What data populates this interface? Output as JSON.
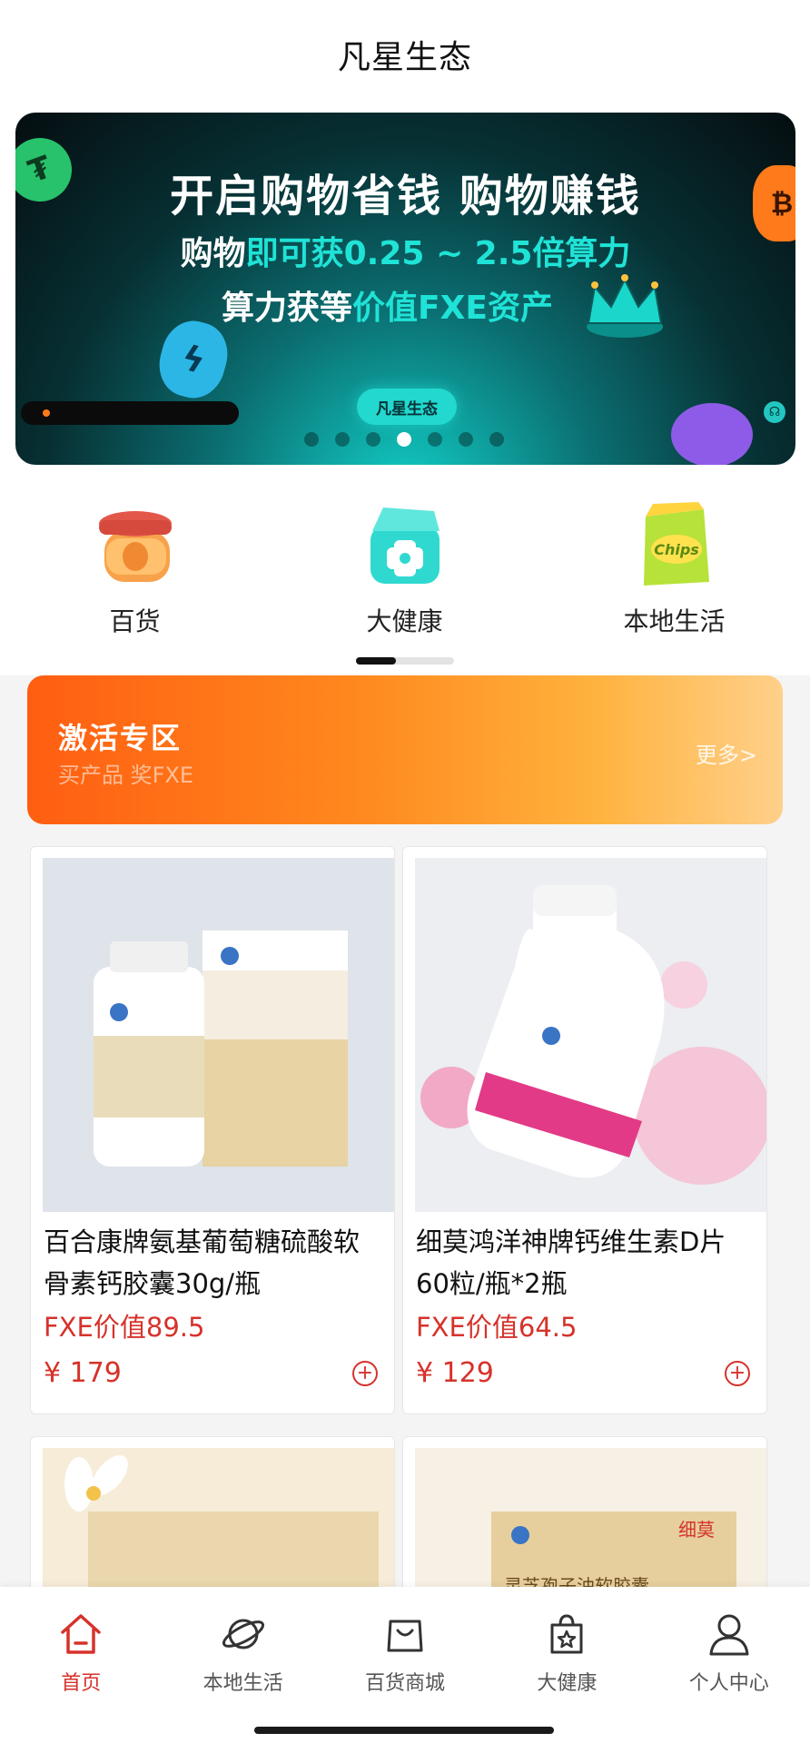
{
  "header": {
    "title": "凡星生态"
  },
  "banner": {
    "line1": "开启购物省钱 购物赚钱",
    "line2_prefix": "购物",
    "line2_highlight": "即可获0.25 ~ 2.5倍算力",
    "line3_prefix": "算力获等",
    "line3_highlight": "价值FXE资产",
    "pill": "凡星生态",
    "page_count": 7,
    "active_page": 4
  },
  "categories": [
    {
      "label": "百货",
      "icon": "jar-icon"
    },
    {
      "label": "大健康",
      "icon": "medical-box-icon"
    },
    {
      "label": "本地生活",
      "icon": "chips-bag-icon"
    }
  ],
  "activation": {
    "title": "激活专区",
    "subtitle": "买产品 奖FXE",
    "more": "更多>"
  },
  "products": [
    {
      "name": "百合康牌氨基葡萄糖硫酸软骨素钙胶囊30g/瓶",
      "fxe": "FXE价值89.5",
      "price": "¥ 179"
    },
    {
      "name": "细莫鸿洋神牌钙维生素D片60粒/瓶*2瓶",
      "fxe": "FXE价值64.5",
      "price": "¥ 129"
    },
    {
      "name": "",
      "fxe": "",
      "price": ""
    },
    {
      "name": "灵芝孢子油软胶囊",
      "fxe": "",
      "price": "",
      "brand": "细莫"
    }
  ],
  "tabbar": {
    "items": [
      {
        "label": "首页",
        "icon": "home-icon",
        "active": true
      },
      {
        "label": "本地生活",
        "icon": "planet-icon",
        "active": false
      },
      {
        "label": "百货商城",
        "icon": "shopping-bag-icon",
        "active": false
      },
      {
        "label": "大健康",
        "icon": "star-bag-icon",
        "active": false
      },
      {
        "label": "个人中心",
        "icon": "person-icon",
        "active": false
      }
    ]
  },
  "colors": {
    "accent": "#d6322b",
    "teal": "#1fe3d6",
    "orange": "#ff6a15"
  }
}
